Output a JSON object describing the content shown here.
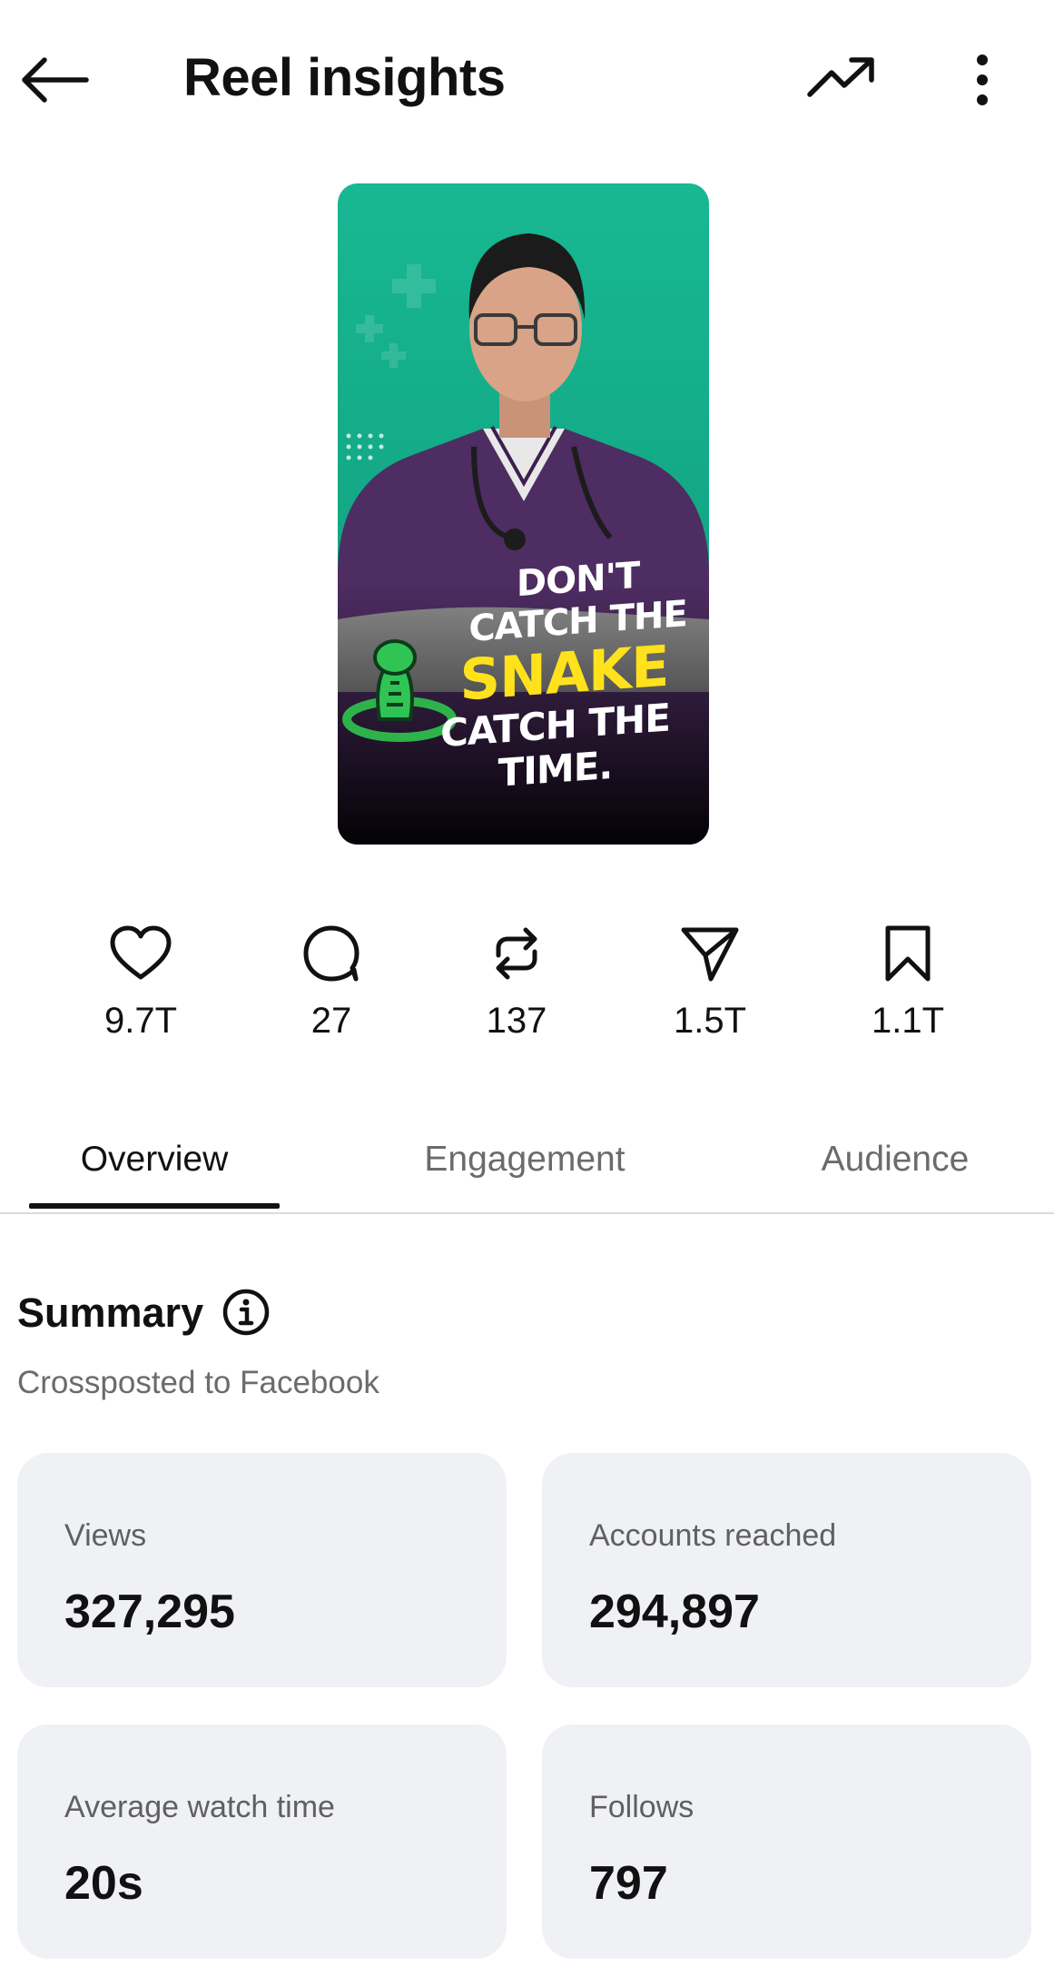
{
  "header": {
    "title": "Reel insights",
    "back_icon": "arrow-left-icon",
    "trend_icon": "trending-up-icon",
    "more_icon": "more-vertical-icon"
  },
  "thumbnail": {
    "caption_line1": "DON'T CATCH THE",
    "caption_line2": "SNAKE",
    "caption_line3": "CATCH THE TIME.",
    "colors": {
      "background": "#17b38e",
      "scrubs": "#4e2d62",
      "highlight": "#ffe21c"
    }
  },
  "stats": [
    {
      "icon": "heart-icon",
      "value": "9.7T"
    },
    {
      "icon": "comment-icon",
      "value": "27"
    },
    {
      "icon": "repost-icon",
      "value": "137"
    },
    {
      "icon": "share-icon",
      "value": "1.5T"
    },
    {
      "icon": "bookmark-icon",
      "value": "1.1T"
    }
  ],
  "tabs": [
    {
      "label": "Overview",
      "active": true
    },
    {
      "label": "Engagement",
      "active": false
    },
    {
      "label": "Audience",
      "active": false
    }
  ],
  "summary": {
    "title": "Summary",
    "info_icon": "info-icon",
    "subtitle": "Crossposted to Facebook",
    "cards": [
      {
        "label": "Views",
        "value": "327,295"
      },
      {
        "label": "Accounts reached",
        "value": "294,897"
      },
      {
        "label": "Average watch time",
        "value": "20s"
      },
      {
        "label": "Follows",
        "value": "797"
      }
    ]
  }
}
